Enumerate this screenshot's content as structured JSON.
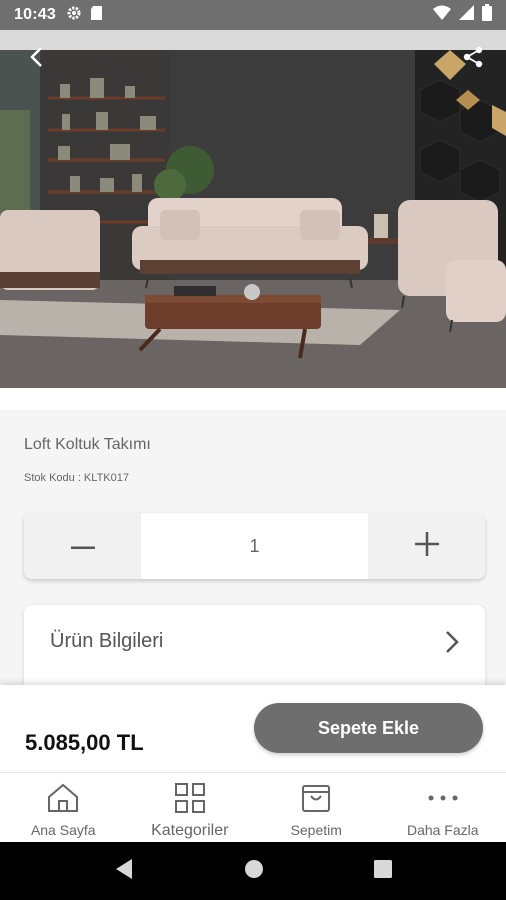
{
  "status_bar": {
    "time": "10:43",
    "left_icons": [
      "gear-icon",
      "sd-card-icon"
    ],
    "right_icons": [
      "wifi-icon",
      "signal-icon",
      "battery-icon"
    ]
  },
  "header": {
    "back_icon": "back-arrow-icon",
    "share_icon": "share-icon"
  },
  "product": {
    "name": "Loft Koltuk Takımı",
    "stock_code": "Stok Kodu : KLTK017",
    "quantity": "1",
    "price": "5.085,00 TL"
  },
  "info_section": {
    "label": "Ürün Bilgileri"
  },
  "actions": {
    "add_to_cart": "Sepete Ekle"
  },
  "bottom_nav": {
    "items": [
      {
        "label": "Ana Sayfa",
        "icon": "home-icon"
      },
      {
        "label": "Kategoriler",
        "icon": "grid-icon"
      },
      {
        "label": "Sepetim",
        "icon": "shopping-bag-icon"
      },
      {
        "label": "Daha Fazla",
        "icon": "more-dots-icon"
      }
    ]
  },
  "colors": {
    "status_bar": "#6f6f6f",
    "button": "#6e6e6e",
    "text": "#666666"
  }
}
